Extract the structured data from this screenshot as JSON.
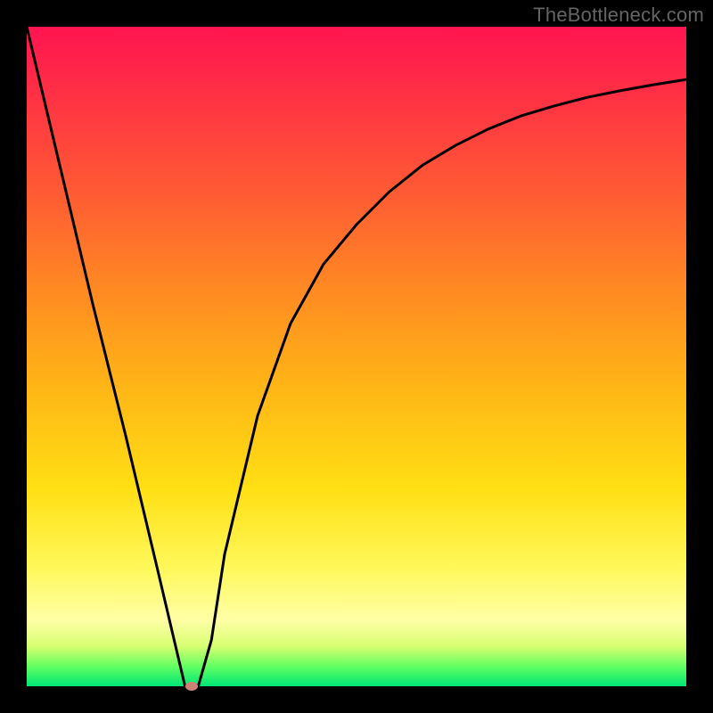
{
  "watermark": "TheBottleneck.com",
  "chart_data": {
    "type": "line",
    "title": "",
    "xlabel": "",
    "ylabel": "",
    "xlim": [
      0,
      100
    ],
    "ylim": [
      0,
      100
    ],
    "grid": false,
    "legend": false,
    "series": [
      {
        "name": "curve",
        "x": [
          0,
          5,
          10,
          15,
          20,
          24,
          26,
          28,
          30,
          35,
          40,
          45,
          50,
          55,
          60,
          65,
          70,
          75,
          80,
          85,
          90,
          95,
          100
        ],
        "y": [
          100,
          79,
          58,
          38,
          17,
          0,
          0,
          7,
          20,
          41,
          55,
          64,
          70,
          75,
          79,
          82,
          84.5,
          86.5,
          88,
          89.3,
          90.3,
          91.2,
          92
        ]
      }
    ],
    "marker": {
      "x": 25,
      "y": 0
    },
    "colors": {
      "frame_bg": "#000000",
      "curve": "#000000",
      "marker": "#cd8074",
      "gradient_top": "#ff1450",
      "gradient_mid": "#ffdf14",
      "gradient_bottom": "#00e676"
    }
  }
}
